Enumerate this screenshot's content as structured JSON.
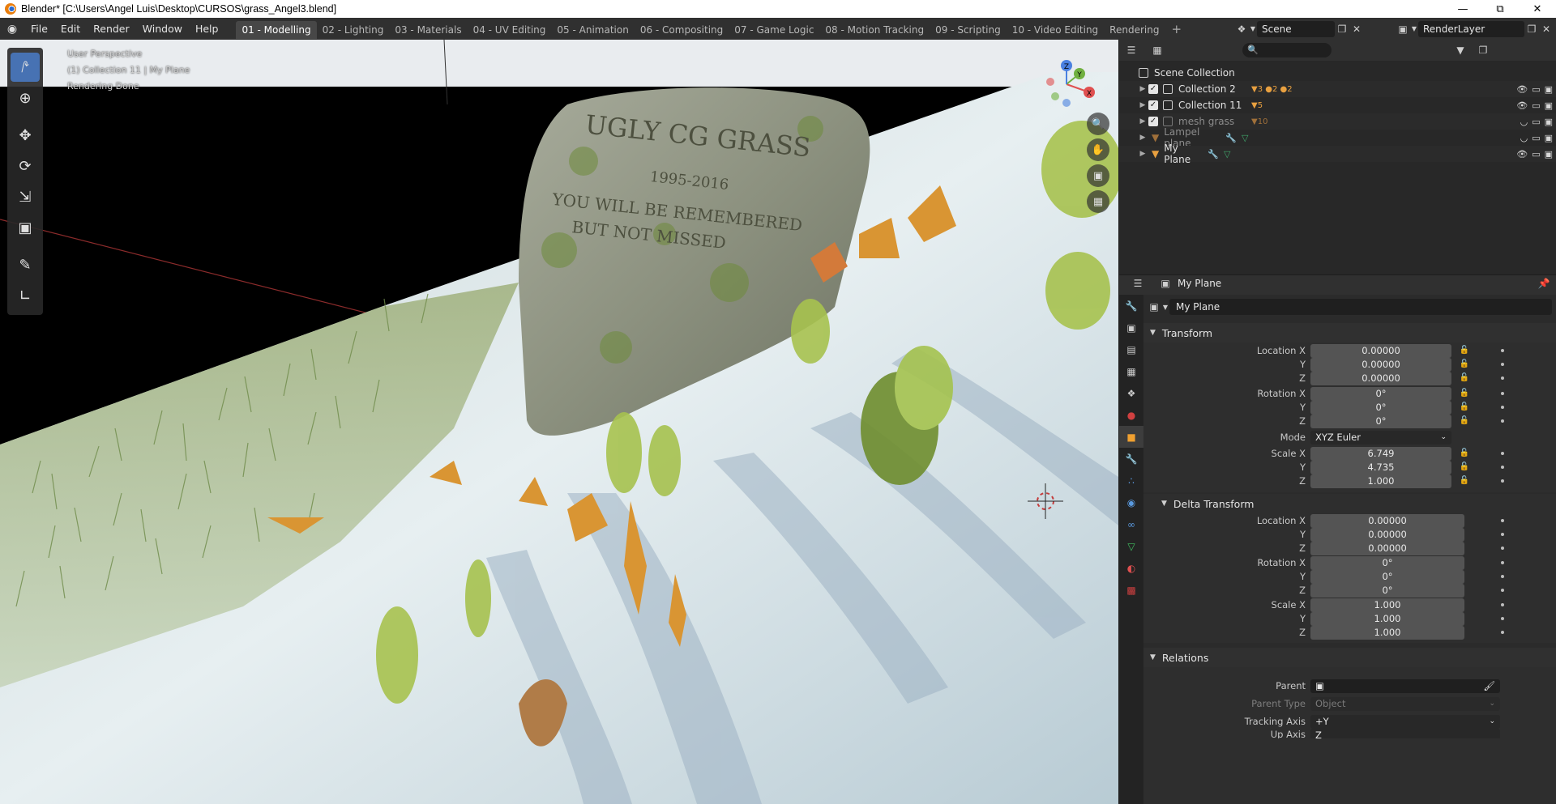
{
  "window": {
    "title": "Blender* [C:\\Users\\Angel Luis\\Desktop\\CURSOS\\grass_Angel3.blend]",
    "controls": [
      "minimize",
      "restore",
      "close"
    ]
  },
  "menu": [
    "File",
    "Edit",
    "Render",
    "Window",
    "Help"
  ],
  "workspaces": {
    "active": "01 - Modelling",
    "tabs": [
      "01 - Modelling",
      "02 - Lighting",
      "03 - Materials",
      "04 - UV Editing",
      "05 - Animation",
      "06 - Compositing",
      "07 - Game Logic",
      "08 - Motion Tracking",
      "09 - Scripting",
      "10 - Video Editing",
      "Rendering"
    ]
  },
  "scene": {
    "name": "Scene"
  },
  "view_layer": {
    "name": "RenderLayer"
  },
  "viewport": {
    "overlay_lines": [
      "User Perspective",
      "(1) Collection 11 | My Plane",
      "Rendering Done"
    ],
    "tombstone": {
      "line1": "UGLY CG GRASS",
      "line2": "1995-2016",
      "line3": "YOU WILL BE REMEMBERED",
      "line4": "BUT NOT MISSED"
    },
    "gizmo_axes": [
      "X",
      "Y",
      "Z"
    ]
  },
  "outliner": {
    "search_placeholder": "",
    "root": "Scene Collection",
    "items": [
      {
        "label": "Collection 2",
        "badges": [
          "3",
          "2",
          "2"
        ],
        "dim": false
      },
      {
        "label": "Collection 11",
        "badges": [
          "5"
        ],
        "dim": false
      },
      {
        "label": "mesh grass",
        "badges": [
          "10"
        ],
        "dim": true
      },
      {
        "label": "Lampel plane",
        "badges": [],
        "dim": true
      },
      {
        "label": "My Plane",
        "badges": [],
        "dim": false
      }
    ]
  },
  "properties": {
    "context": "My Plane",
    "object_name": "My Plane",
    "transform": {
      "title": "Transform",
      "location": {
        "label": "Location X",
        "x": "0.00000",
        "y": "0.00000",
        "z": "0.00000"
      },
      "rotation": {
        "label": "Rotation X",
        "x": "0°",
        "y": "0°",
        "z": "0°"
      },
      "mode": {
        "label": "Mode",
        "value": "XYZ Euler"
      },
      "scale": {
        "label": "Scale X",
        "x": "6.749",
        "y": "4.735",
        "z": "1.000"
      }
    },
    "delta": {
      "title": "Delta Transform",
      "location": {
        "label": "Location X",
        "x": "0.00000",
        "y": "0.00000",
        "z": "0.00000"
      },
      "rotation": {
        "label": "Rotation X",
        "x": "0°",
        "y": "0°",
        "z": "0°"
      },
      "scale": {
        "label": "Scale X",
        "x": "1.000",
        "y": "1.000",
        "z": "1.000"
      }
    },
    "relations": {
      "title": "Relations",
      "parent_label": "Parent",
      "parent_value": "",
      "parent_type_label": "Parent Type",
      "parent_type_value": "Object",
      "tracking_label": "Tracking Axis",
      "tracking_value": "+Y",
      "up_label": "Up Axis",
      "up_value": "Z"
    },
    "axis_y": "Y",
    "axis_z": "Z"
  }
}
